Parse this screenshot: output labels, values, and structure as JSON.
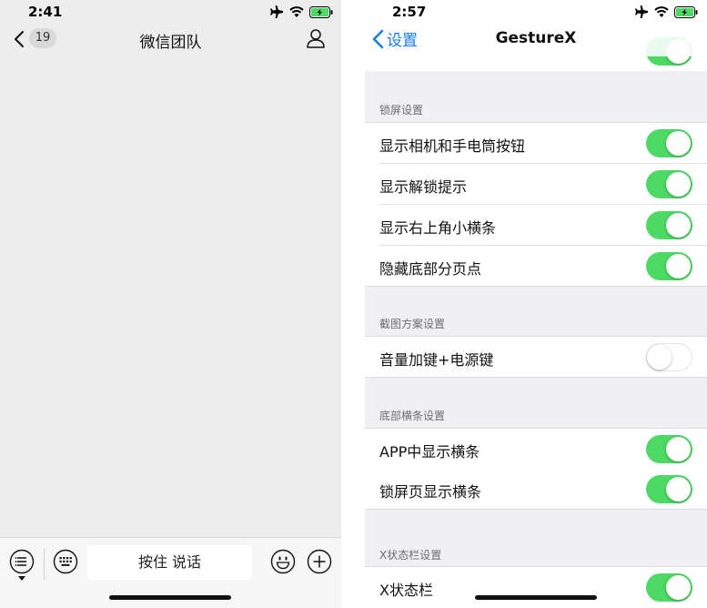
{
  "left_screen": {
    "status_bar": {
      "time": "2:41"
    },
    "nav": {
      "unread_count": "19",
      "title": "微信团队"
    },
    "input_bar": {
      "talk_label": "按住 说话"
    }
  },
  "right_screen": {
    "status_bar": {
      "time": "2:57"
    },
    "nav": {
      "back_label": "设置",
      "title": "GestureX"
    },
    "sections": [
      {
        "header": "锁屏设置",
        "rows": [
          {
            "label": "显示相机和手电筒按钮",
            "enabled": true
          },
          {
            "label": "显示解锁提示",
            "enabled": true
          },
          {
            "label": "显示右上角小横条",
            "enabled": true
          },
          {
            "label": "隐藏底部分页点",
            "enabled": true
          }
        ]
      },
      {
        "header": "截图方案设置",
        "rows": [
          {
            "label": "音量加键+电源键",
            "enabled": false
          }
        ]
      },
      {
        "header": "底部横条设置",
        "rows": [
          {
            "label": "APP中显示横条",
            "enabled": true
          },
          {
            "label": "锁屏页显示横条",
            "enabled": true
          }
        ]
      },
      {
        "header": "X状态栏设置",
        "rows": [
          {
            "label": "X状态栏",
            "enabled": true
          }
        ]
      }
    ]
  },
  "colors": {
    "toggle_on": "#4cd964",
    "ios_blue": "#1a7cf3",
    "wechat_bg": "#ededed"
  }
}
